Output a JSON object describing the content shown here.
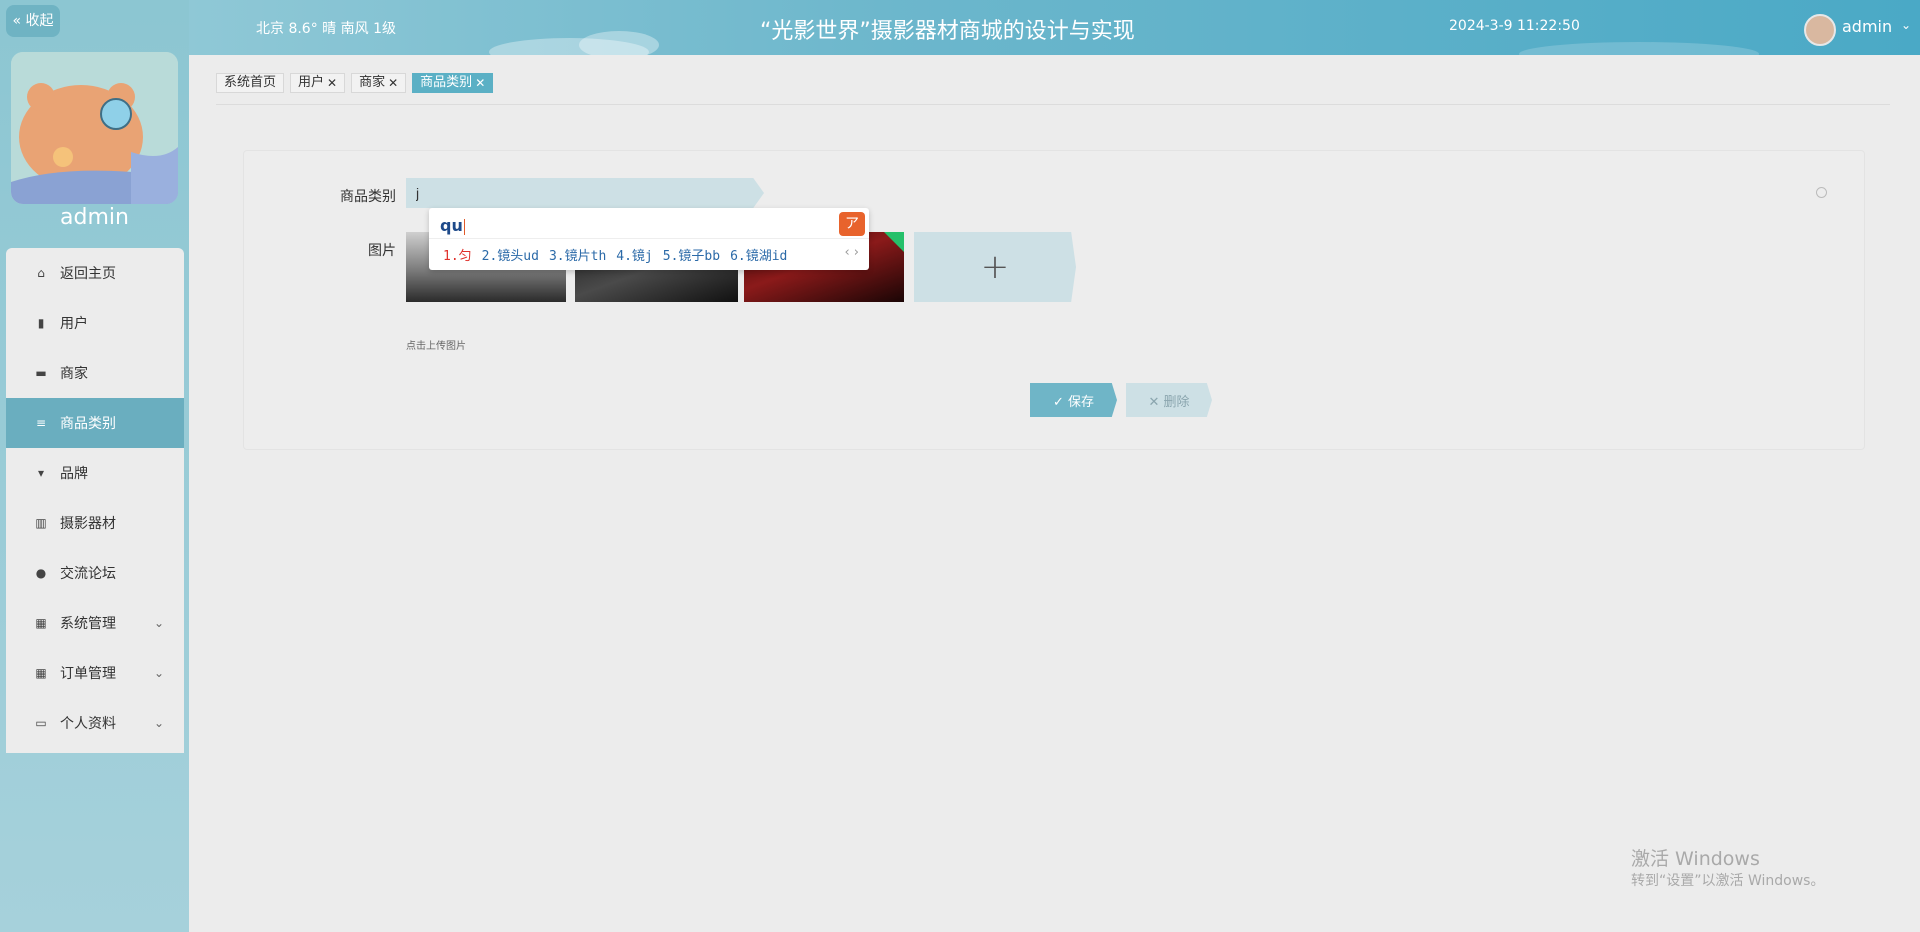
{
  "sidebar": {
    "collapse_label": "« 收起",
    "username": "admin",
    "items": [
      {
        "label": "返回主页",
        "icon": "home-icon",
        "glyph": "⌂"
      },
      {
        "label": "用户",
        "icon": "user-clipboard-icon",
        "glyph": "▮"
      },
      {
        "label": "商家",
        "icon": "shop-icon",
        "glyph": "▬"
      },
      {
        "label": "商品类别",
        "icon": "list-icon",
        "glyph": "≡"
      },
      {
        "label": "品牌",
        "icon": "brand-icon",
        "glyph": "▾"
      },
      {
        "label": "摄影器材",
        "icon": "bars-icon",
        "glyph": "▥"
      },
      {
        "label": "交流论坛",
        "icon": "person-icon",
        "glyph": "●"
      },
      {
        "label": "系统管理",
        "icon": "grid-icon",
        "glyph": "▦"
      },
      {
        "label": "订单管理",
        "icon": "grid-icon",
        "glyph": "▦"
      },
      {
        "label": "个人资料",
        "icon": "card-icon",
        "glyph": "▭"
      }
    ]
  },
  "header": {
    "weather": "北京  8.6°  晴  南风  1级",
    "title": "“光影世界”摄影器材商城的设计与实现",
    "datetime": "2024-3-9 11:22:50",
    "username": "admin",
    "dropdown": "⌄"
  },
  "tabs": [
    {
      "label": "系统首页",
      "closable": false
    },
    {
      "label": "用户",
      "closable": true
    },
    {
      "label": "商家",
      "closable": true
    },
    {
      "label": "商品类别",
      "closable": true
    }
  ],
  "form": {
    "category_label": "商品类别",
    "category_value": "j",
    "image_label": "图片",
    "upload_plus": "+",
    "upload_hint": "点击上传图片",
    "save_label": "✓ 保存",
    "delete_label": "✕ 删除"
  },
  "ime": {
    "composition": "qu",
    "logo": "ア",
    "candidates": [
      "1.匀",
      "2.镜头ud",
      "3.镜片th",
      "4.镜j",
      "5.镜子bb",
      "6.镜湖id"
    ],
    "arrows": "‹ ›"
  },
  "watermark": {
    "line1": "激活 Windows",
    "line2": "转到“设置”以激活 Windows。"
  }
}
